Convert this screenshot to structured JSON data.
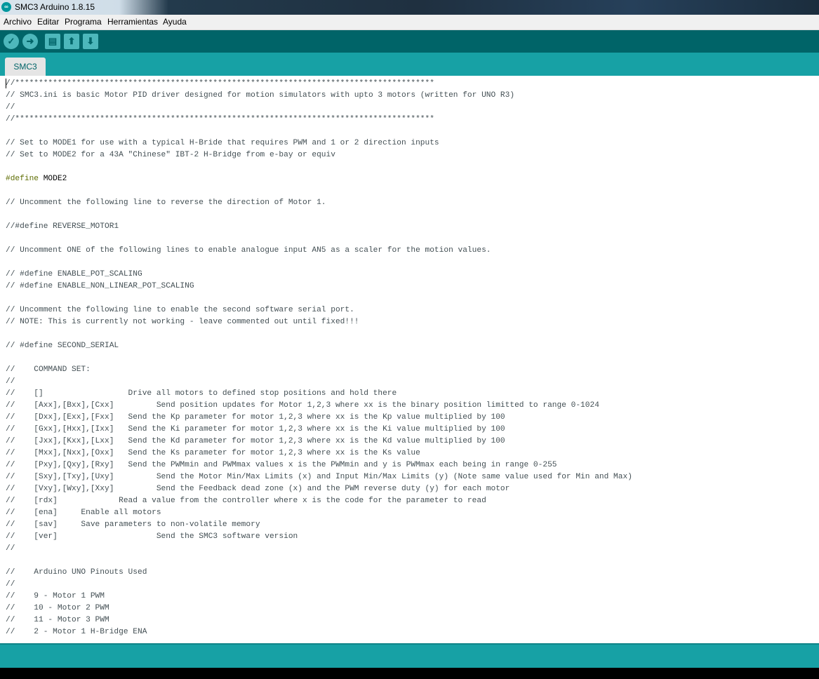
{
  "window": {
    "title": "SMC3 Arduino 1.8.15",
    "logo_glyph": "∞"
  },
  "menu": [
    "Archivo",
    "Editar",
    "Programa",
    "Herramientas",
    "Ayuda"
  ],
  "toolbar": {
    "verify_icon": "✓",
    "upload_icon": "➜",
    "new_icon": "▤",
    "open_icon": "⬆",
    "save_icon": "⬇"
  },
  "tabs": [
    {
      "label": "SMC3"
    }
  ],
  "editor": {
    "lines": [
      "//*****************************************************************************************",
      "// SMC3.ini is basic Motor PID driver designed for motion simulators with upto 3 motors (written for UNO R3)",
      "//",
      "//*****************************************************************************************",
      "",
      "// Set to MODE1 for use with a typical H-Bride that requires PWM and 1 or 2 direction inputs",
      "// Set to MODE2 for a 43A \"Chinese\" IBT-2 H-Bridge from e-bay or equiv",
      "",
      "#define MODE2",
      "",
      "// Uncomment the following line to reverse the direction of Motor 1.",
      "",
      "//#define REVERSE_MOTOR1",
      "",
      "// Uncomment ONE of the following lines to enable analogue input AN5 as a scaler for the motion values.",
      "",
      "// #define ENABLE_POT_SCALING",
      "// #define ENABLE_NON_LINEAR_POT_SCALING",
      "",
      "// Uncomment the following line to enable the second software serial port.",
      "// NOTE: This is currently not working - leave commented out until fixed!!!",
      "",
      "// #define SECOND_SERIAL",
      "",
      "//    COMMAND SET:",
      "//",
      "//    []                  Drive all motors to defined stop positions and hold there",
      "//    [Axx],[Bxx],[Cxx]         Send position updates for Motor 1,2,3 where xx is the binary position limitted to range 0-1024",
      "//    [Dxx],[Exx],[Fxx]   Send the Kp parameter for motor 1,2,3 where xx is the Kp value multiplied by 100",
      "//    [Gxx],[Hxx],[Ixx]   Send the Ki parameter for motor 1,2,3 where xx is the Ki value multiplied by 100",
      "//    [Jxx],[Kxx],[Lxx]   Send the Kd parameter for motor 1,2,3 where xx is the Kd value multiplied by 100",
      "//    [Mxx],[Nxx],[Oxx]   Send the Ks parameter for motor 1,2,3 where xx is the Ks value",
      "//    [Pxy],[Qxy],[Rxy]   Send the PWMmin and PWMmax values x is the PWMmin and y is PWMmax each being in range 0-255",
      "//    [Sxy],[Txy],[Uxy]         Send the Motor Min/Max Limits (x) and Input Min/Max Limits (y) (Note same value used for Min and Max)",
      "//    [Vxy],[Wxy],[Xxy]         Send the Feedback dead zone (x) and the PWM reverse duty (y) for each motor",
      "//    [rdx]             Read a value from the controller where x is the code for the parameter to read",
      "//    [ena]     Enable all motors",
      "//    [sav]     Save parameters to non-volatile memory",
      "//    [ver]                     Send the SMC3 software version",
      "//",
      "",
      "//    Arduino UNO Pinouts Used",
      "//",
      "//    9 - Motor 1 PWM",
      "//    10 - Motor 2 PWM",
      "//    11 - Motor 3 PWM",
      "//    2 - Motor 1 H-Bridge ENA"
    ]
  }
}
